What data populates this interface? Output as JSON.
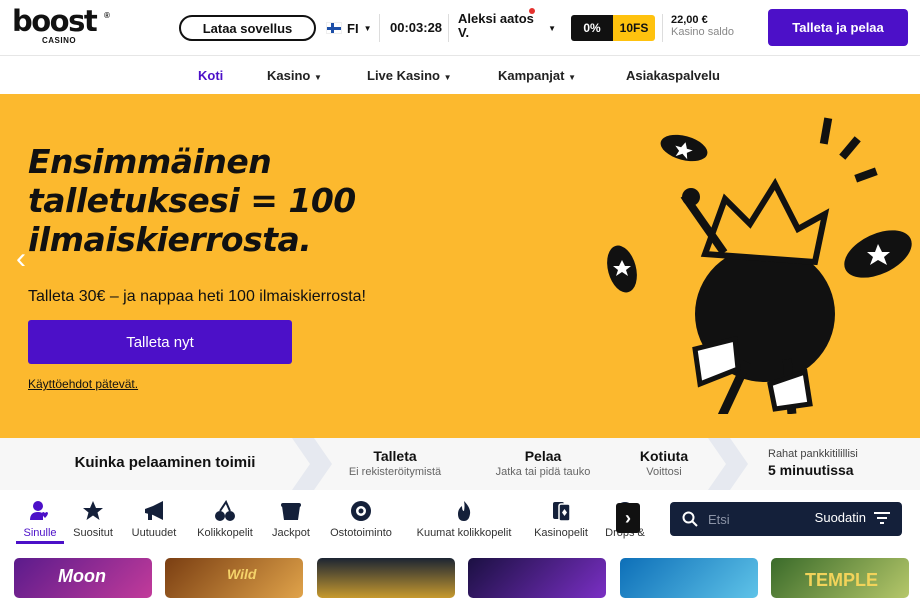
{
  "brand": {
    "logo_word": "boost",
    "logo_sub": "CASINO",
    "logo_mark": "®"
  },
  "header": {
    "app_button": "Lataa sovellus",
    "language": "FI",
    "session_time": "00:03:28",
    "user_name": "Aleksi aatos V.",
    "bonus_percent": "0%",
    "bonus_spins": "10FS",
    "balance_value": "22,00 €",
    "balance_label": "Kasino saldo",
    "deposit_button": "Talleta ja pelaa"
  },
  "nav": {
    "items": [
      "Koti",
      "Kasino",
      "Live Kasino",
      "Kampanjat",
      "Asiakaspalvelu"
    ],
    "active": "Koti"
  },
  "hero": {
    "title": "Ensimmäinen talletuksesi = 100 ilmaiskierrosta.",
    "subtitle": "Talleta 30€ – ja nappaa heti 100 ilmaiskierrosta!",
    "cta": "Talleta nyt",
    "terms": "Käyttöehdot pätevät."
  },
  "steps": {
    "intro": "Kuinka pelaaminen toimii",
    "items": [
      {
        "title": "Talleta",
        "sub": "Ei rekisteröitymistä"
      },
      {
        "title": "Pelaa",
        "sub": "Jatka tai pidä tauko"
      },
      {
        "title": "Kotiuta",
        "sub": "Voittosi"
      }
    ],
    "payout_label": "Rahat pankkitilillisi",
    "payout_value": "5 minuutissa"
  },
  "categories": [
    {
      "label": "Sinulle",
      "icon": "user-heart-icon"
    },
    {
      "label": "Suositut",
      "icon": "star-icon"
    },
    {
      "label": "Uutuudet",
      "icon": "megaphone-icon"
    },
    {
      "label": "Kolikkopelit",
      "icon": "cherries-icon"
    },
    {
      "label": "Jackpot",
      "icon": "pot-icon"
    },
    {
      "label": "Ostotoiminto",
      "icon": "cart-icon"
    },
    {
      "label": "Kuumat kolikkopelit",
      "icon": "flame-icon"
    },
    {
      "label": "Kasinopelit",
      "icon": "cards-icon"
    },
    {
      "label": "Drops &",
      "icon": "drops-icon"
    }
  ],
  "search": {
    "placeholder": "Etsi",
    "filter_label": "Suodatin"
  },
  "tiles": [
    {
      "text": "Moon"
    },
    {
      "text": "Wild"
    },
    {
      "text": ""
    },
    {
      "text": ""
    },
    {
      "text": ""
    },
    {
      "text": "TEMPLE"
    }
  ],
  "colors": {
    "accent": "#4c10c8",
    "hero_bg": "#fcb92e",
    "bonus_yellow": "#ffc20e",
    "dark": "#14203a"
  }
}
